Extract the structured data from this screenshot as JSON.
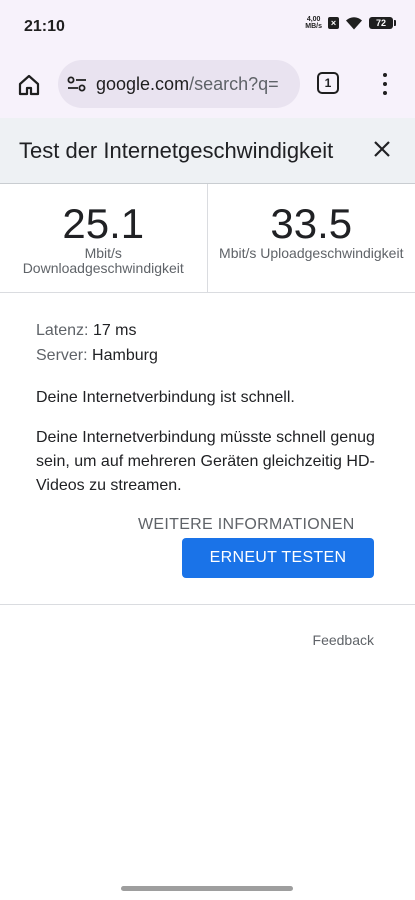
{
  "status_bar": {
    "time": "21:10",
    "net_speed_value": "4,00",
    "net_speed_unit": "MB/s",
    "battery_level": "72",
    "icons": [
      "x-icon",
      "wifi-icon",
      "battery-icon"
    ]
  },
  "toolbar": {
    "url_host": "google.com",
    "url_path": "/search?q=",
    "tab_count": "1",
    "icons": [
      "home-icon",
      "site-settings-icon",
      "tab-switcher-icon",
      "more-menu-icon"
    ]
  },
  "panel": {
    "title": "Test der Internetgeschwindigkeit",
    "close_icon": "close-icon"
  },
  "download": {
    "value": "25.1",
    "unit_line1": "Mbit/s",
    "unit_line2": "Downloadgeschwindigkeit"
  },
  "upload": {
    "value": "33.5",
    "unit": "Mbit/s Uploadgeschwindigkeit"
  },
  "details": {
    "latency_label": "Latenz:",
    "latency_value": "17 ms",
    "server_label": "Server:",
    "server_value": "Hamburg",
    "result": "Deine Internetverbindung ist schnell.",
    "result_detail": "Deine Internetverbindung müsste schnell genug sein, um auf mehreren Geräten gleichzeitig HD-Videos zu streamen."
  },
  "actions": {
    "more_info": "WEITERE INFORMATIONEN",
    "retest": "ERNEUT TESTEN",
    "feedback": "Feedback"
  },
  "colors": {
    "accent": "#1a73e8",
    "header_bg": "#eef1f4",
    "browser_bg": "#f7f2fb"
  }
}
